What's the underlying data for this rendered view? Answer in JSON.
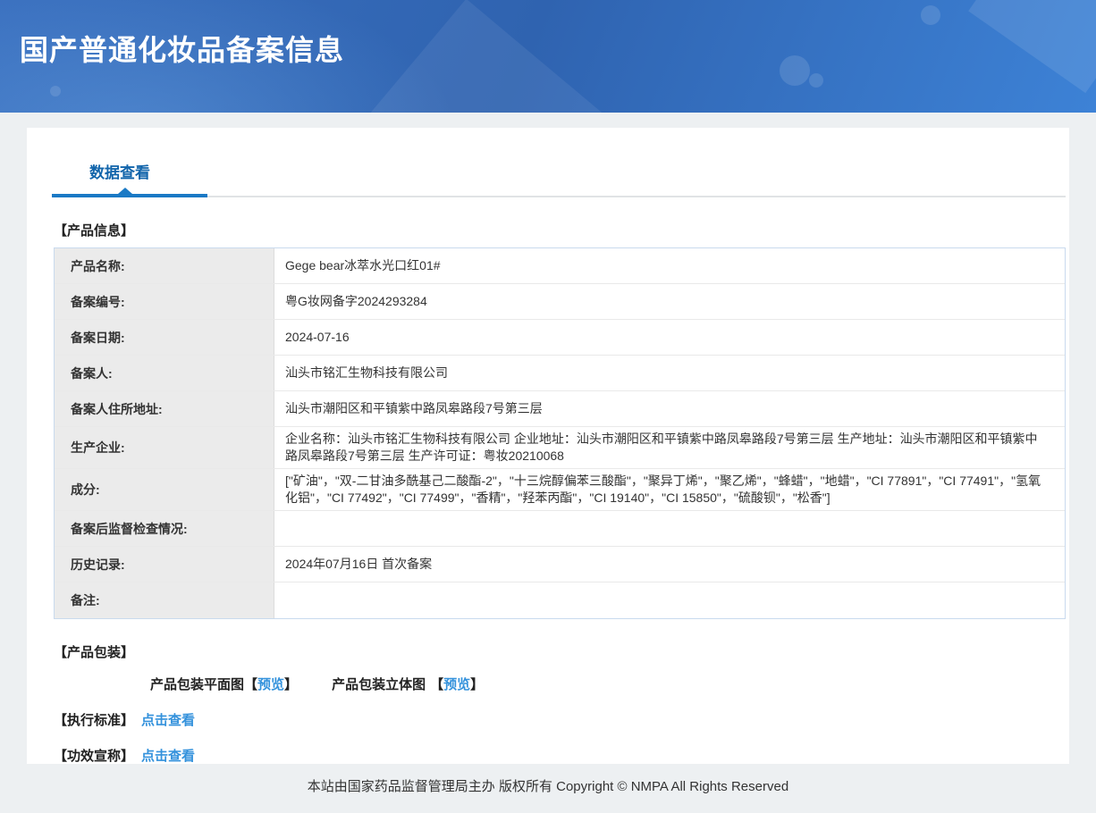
{
  "header": {
    "title": "国产普通化妆品备案信息"
  },
  "tab": {
    "label": "数据查看"
  },
  "product_info": {
    "heading": "【产品信息】",
    "rows": [
      {
        "label": "产品名称:",
        "value": "Gege bear冰萃水光口红01#"
      },
      {
        "label": "备案编号:",
        "value": "粤G妆网备字2024293284"
      },
      {
        "label": "备案日期:",
        "value": "2024-07-16"
      },
      {
        "label": "备案人:",
        "value": "汕头市铭汇生物科技有限公司"
      },
      {
        "label": "备案人住所地址:",
        "value": "汕头市潮阳区和平镇紫中路凤皋路段7号第三层"
      },
      {
        "label": "生产企业:",
        "value": "企业名称：汕头市铭汇生物科技有限公司 企业地址：汕头市潮阳区和平镇紫中路凤皋路段7号第三层 生产地址：汕头市潮阳区和平镇紫中路凤皋路段7号第三层 生产许可证：粤妆20210068"
      },
      {
        "label": "成分:",
        "value": "[\"矿油\"，\"双-二甘油多酰基己二酸酯-2\"，\"十三烷醇偏苯三酸酯\"，\"聚异丁烯\"，\"聚乙烯\"，\"蜂蜡\"，\"地蜡\"，\"CI 77891\"，\"CI 77491\"，\"氢氧化铝\"，\"CI 77492\"，\"CI 77499\"，\"香精\"，\"羟苯丙酯\"，\"CI 19140\"，\"CI 15850\"，\"硫酸钡\"，\"松香\"]"
      },
      {
        "label": "备案后监督检查情况:",
        "value": ""
      },
      {
        "label": "历史记录:",
        "value": "2024年07月16日 首次备案"
      },
      {
        "label": "备注:",
        "value": ""
      }
    ]
  },
  "packaging": {
    "heading": "【产品包装】",
    "flat": {
      "label": "产品包装平面图",
      "bracket_open": "【",
      "link": "预览",
      "bracket_close": "】"
    },
    "stereo": {
      "label": "产品包装立体图",
      "bracket_open": "【",
      "link": "预览",
      "bracket_close": "】"
    }
  },
  "standard": {
    "heading": "【执行标准】",
    "link": "点击查看"
  },
  "efficacy": {
    "heading": "【功效宣称】",
    "link": "点击查看"
  },
  "footer": {
    "text": "本站由国家药品监督管理局主办 版权所有 Copyright © NMPA All Rights Reserved"
  },
  "colors": {
    "banner_blue_dark": "#2f63b0",
    "banner_blue_light": "#3d82d6",
    "tab_blue": "#1265ab",
    "tab_indicator_blue": "#1a79c5",
    "link_blue": "#3492dc",
    "label_cell_bg": "#ebebeb",
    "table_border": "#c9daee",
    "page_bg": "#edf0f2"
  }
}
